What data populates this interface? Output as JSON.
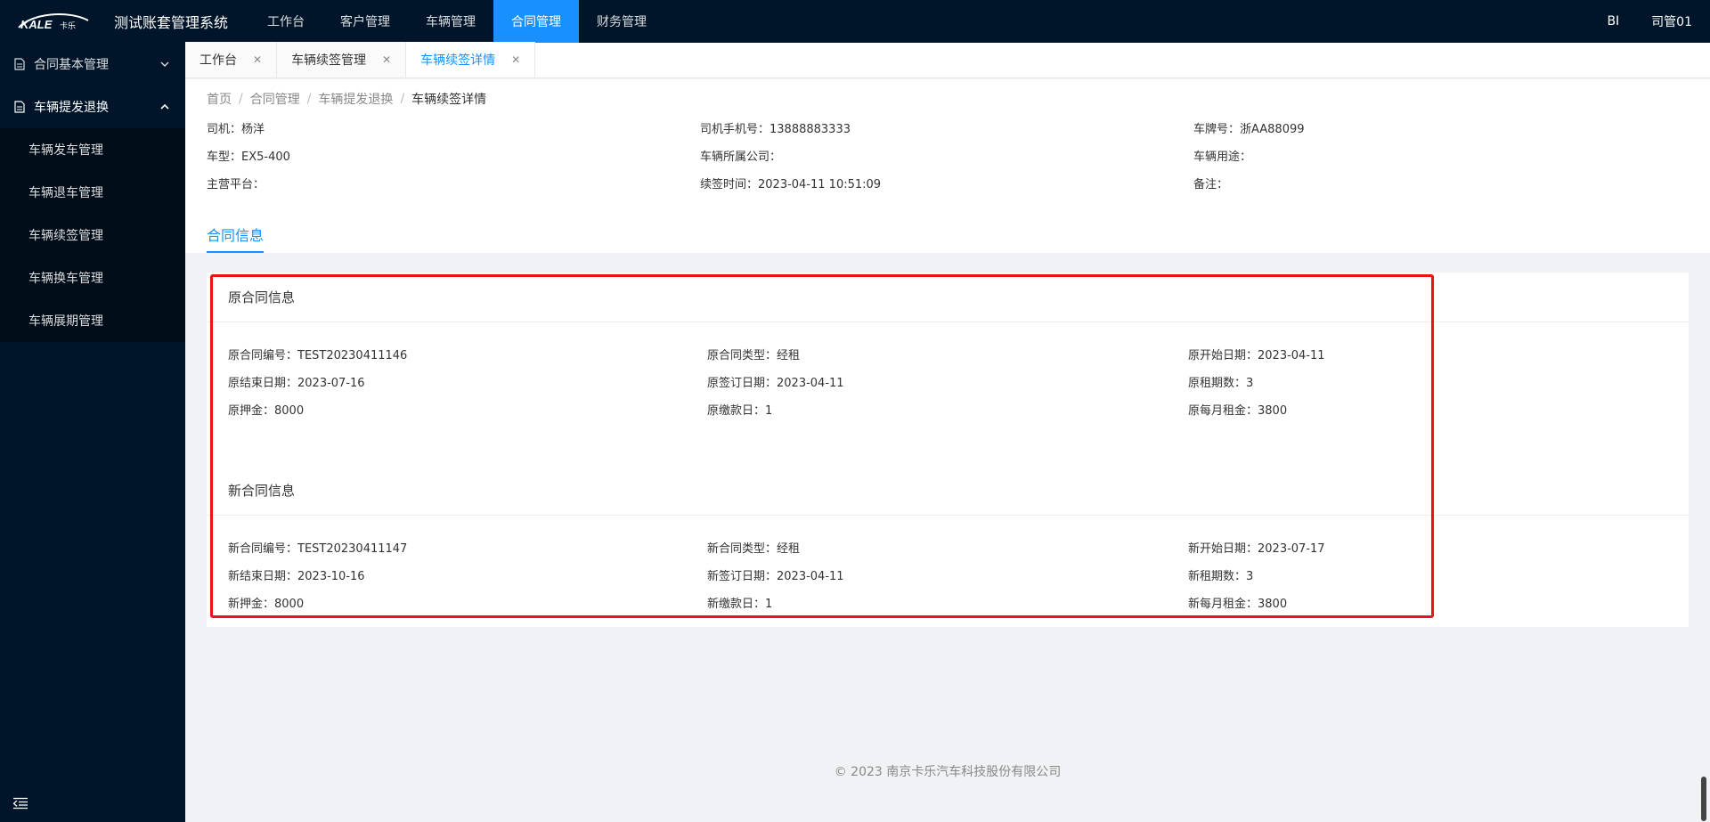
{
  "app": {
    "logo_text": "KALE卡乐",
    "title": "测试账套管理系统"
  },
  "topnav": {
    "items": [
      {
        "label": "工作台"
      },
      {
        "label": "客户管理"
      },
      {
        "label": "车辆管理"
      },
      {
        "label": "合同管理"
      },
      {
        "label": "财务管理"
      }
    ],
    "active_index": 3,
    "right_bi": "BI",
    "user": "司管01"
  },
  "sidebar": {
    "groups": [
      {
        "label": "合同基本管理",
        "icon": "document-icon",
        "open": false
      },
      {
        "label": "车辆提发退换",
        "icon": "document-icon",
        "open": true
      }
    ],
    "subitems": [
      {
        "label": "车辆发车管理"
      },
      {
        "label": "车辆退车管理"
      },
      {
        "label": "车辆续签管理"
      },
      {
        "label": "车辆换车管理"
      },
      {
        "label": "车辆展期管理"
      }
    ]
  },
  "tabs": [
    {
      "label": "工作台",
      "active": false
    },
    {
      "label": "车辆续签管理",
      "active": false
    },
    {
      "label": "车辆续签详情",
      "active": true
    }
  ],
  "breadcrumb": [
    "首页",
    "合同管理",
    "车辆提发退换",
    "车辆续签详情"
  ],
  "header_info": [
    {
      "text": "司机：杨洋"
    },
    {
      "text": "司机手机号：13888883333"
    },
    {
      "text": "车牌号：浙AA88099"
    },
    {
      "text": "车型：EX5-400"
    },
    {
      "text": "车辆所属公司："
    },
    {
      "text": "车辆用途："
    },
    {
      "text": "主营平台："
    },
    {
      "text": "续签时间：2023-04-11 10:51:09"
    },
    {
      "text": "备注："
    }
  ],
  "section_tab": "合同信息",
  "original_contract": {
    "title": "原合同信息",
    "fields": [
      {
        "text": "原合同编号：TEST20230411146"
      },
      {
        "text": "原合同类型：经租"
      },
      {
        "text": "原开始日期：2023-04-11"
      },
      {
        "text": "原结束日期：2023-07-16"
      },
      {
        "text": "原签订日期：2023-04-11"
      },
      {
        "text": "原租期数：3"
      },
      {
        "text": "原押金：8000"
      },
      {
        "text": "原缴款日：1"
      },
      {
        "text": "原每月租金：3800"
      }
    ]
  },
  "new_contract": {
    "title": "新合同信息",
    "fields": [
      {
        "text": "新合同编号：TEST20230411147"
      },
      {
        "text": "新合同类型：经租"
      },
      {
        "text": "新开始日期：2023-07-17"
      },
      {
        "text": "新结束日期：2023-10-16"
      },
      {
        "text": "新签订日期：2023-04-11"
      },
      {
        "text": "新租期数：3"
      },
      {
        "text": "新押金：8000"
      },
      {
        "text": "新缴款日：1"
      },
      {
        "text": "新每月租金：3800"
      }
    ]
  },
  "footer": "© 2023 南京卡乐汽车科技股份有限公司",
  "colors": {
    "nav_bg": "#001529",
    "accent": "#1890ff",
    "highlight": "#e8141a"
  }
}
